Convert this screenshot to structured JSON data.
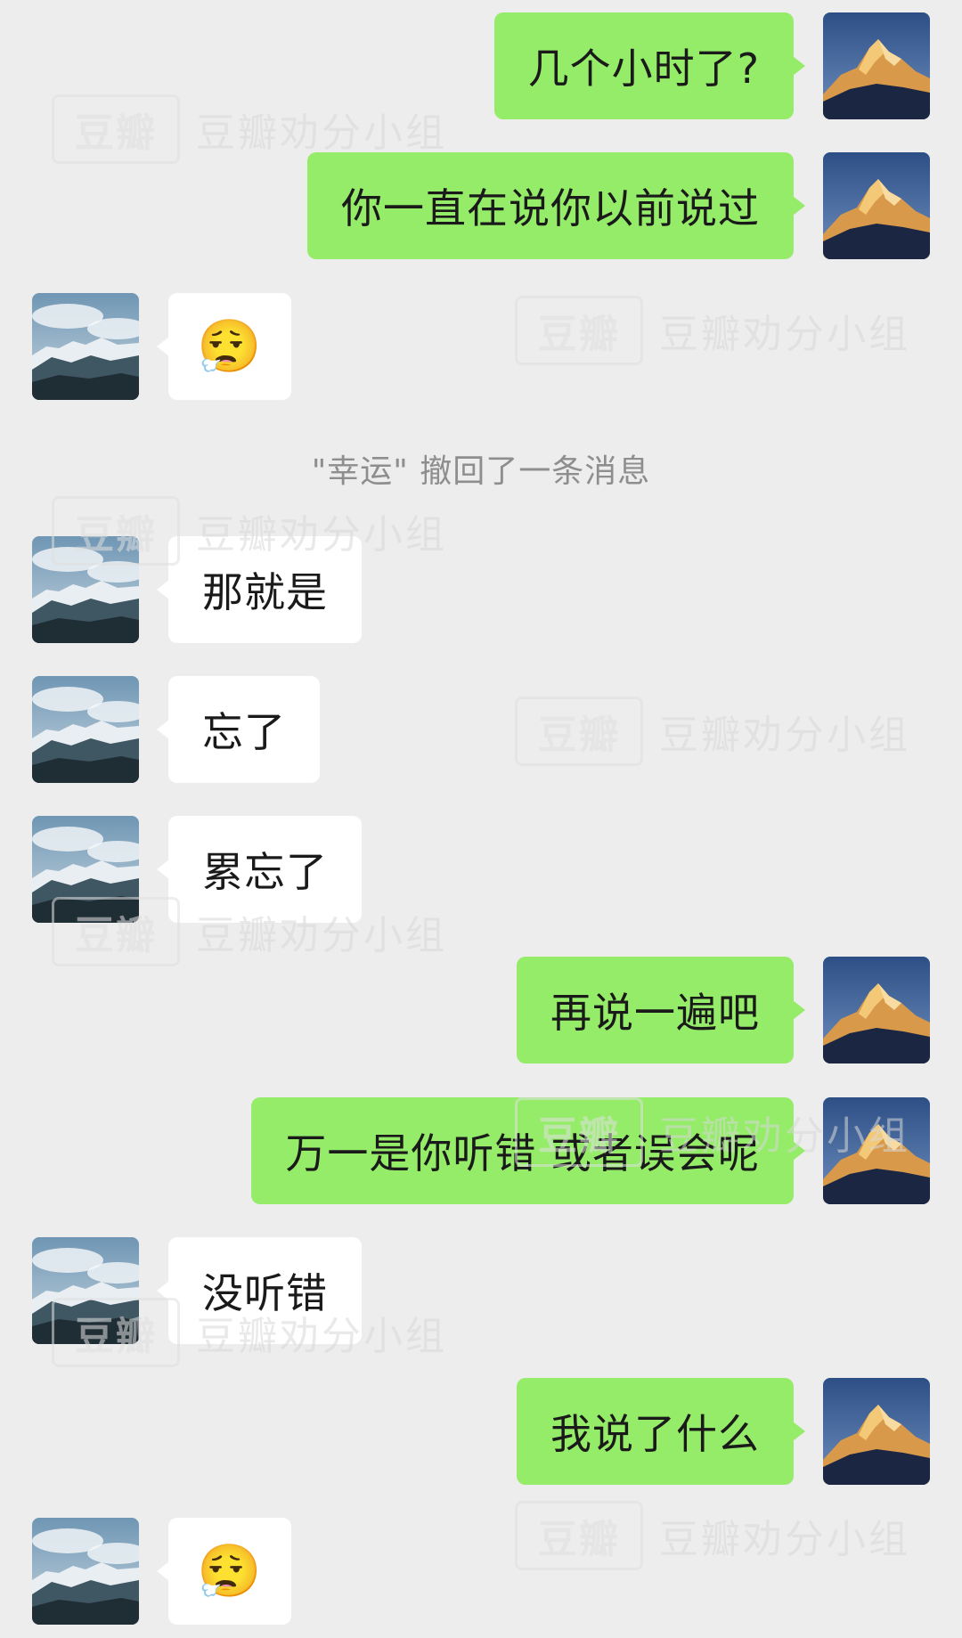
{
  "conversation": {
    "messages": [
      {
        "side": "out",
        "type": "text",
        "text": "几个小时了?"
      },
      {
        "side": "out",
        "type": "text",
        "text": "你一直在说你以前说过"
      },
      {
        "side": "in",
        "type": "emoji",
        "emoji": "😮‍💨"
      },
      {
        "side": "in",
        "type": "text",
        "text": "那就是"
      },
      {
        "side": "in",
        "type": "text",
        "text": "忘了"
      },
      {
        "side": "in",
        "type": "text",
        "text": "累忘了"
      },
      {
        "side": "out",
        "type": "text",
        "text": "再说一遍吧"
      },
      {
        "side": "out",
        "type": "text",
        "text": "万一是你听错 或者误会呢"
      },
      {
        "side": "in",
        "type": "text",
        "text": "没听错"
      },
      {
        "side": "out",
        "type": "text",
        "text": "我说了什么"
      },
      {
        "side": "in",
        "type": "emoji",
        "emoji": "😮‍💨"
      }
    ],
    "system_note": "\"幸运\" 撤回了一条消息"
  },
  "watermark": {
    "logo_text": "豆瓣",
    "group_name": "豆瓣劝分小组"
  },
  "colors": {
    "background": "#ededed",
    "outgoing_bubble": "#95ec69",
    "incoming_bubble": "#ffffff",
    "system_text": "#8e8e8e"
  },
  "icons": {
    "self_avatar": "golden-snow-mountain-avatar",
    "contact_avatar": "cloudy-snow-mountain-avatar"
  }
}
